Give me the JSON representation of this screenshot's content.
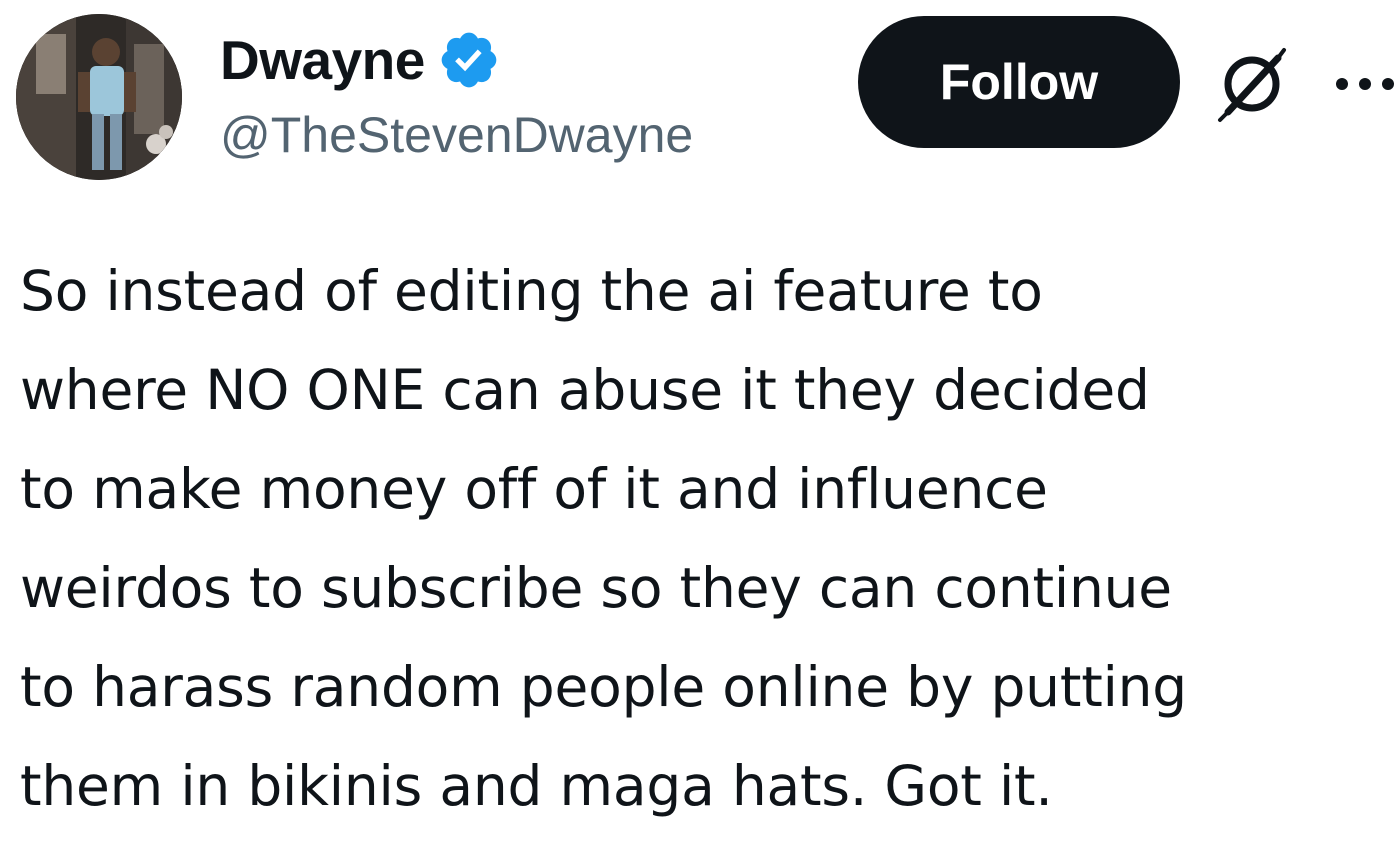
{
  "author": {
    "display_name": "Dwayne",
    "handle": "@TheStevenDwayne",
    "verified": true
  },
  "actions": {
    "follow_label": "Follow",
    "grok_icon": "grok-icon",
    "more_icon": "more-icon"
  },
  "tweet": {
    "text": "So instead of editing the ai feature to\nwhere NO ONE can abuse it they decided\nto make money off of it and influence\nweirdos to subscribe so they can continue\nto harass random people online by putting\nthem in bikinis and maga hats. Got it."
  },
  "colors": {
    "text": "#0f1419",
    "secondary": "#536471",
    "verified_blue": "#1d9bf0",
    "follow_bg": "#0f1419",
    "follow_text": "#ffffff",
    "background": "#ffffff"
  }
}
